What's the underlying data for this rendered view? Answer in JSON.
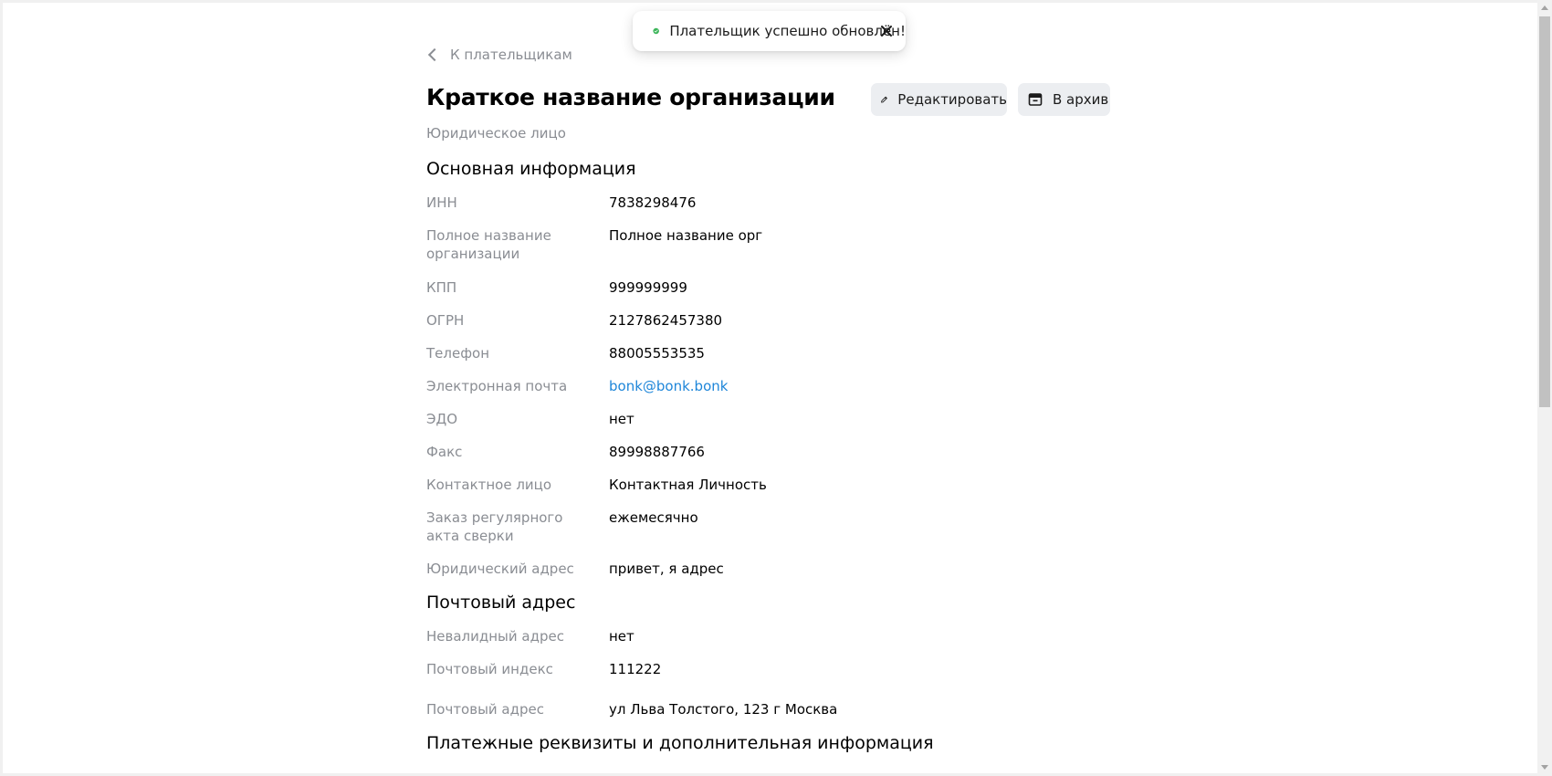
{
  "toast": {
    "message": "Плательщик успешно обновлён!",
    "success_color": "#3bb559"
  },
  "header": {
    "back_label": "К плательщикам",
    "title": "Краткое название организации",
    "subtitle": "Юридическое лицо",
    "edit_label": "Редактировать",
    "archive_label": "В архив"
  },
  "sections": {
    "main": {
      "title": "Основная информация",
      "rows": [
        {
          "label": "ИНН",
          "value": "7838298476"
        },
        {
          "label": "Полное название организации",
          "value": "Полное название орг"
        },
        {
          "label": "КПП",
          "value": "999999999"
        },
        {
          "label": "ОГРН",
          "value": "2127862457380"
        },
        {
          "label": "Телефон",
          "value": "88005553535"
        },
        {
          "label": "Электронная почта",
          "value": "bonk@bonk.bonk"
        },
        {
          "label": "ЭДО",
          "value": "нет"
        },
        {
          "label": "Факс",
          "value": "89998887766"
        },
        {
          "label": "Контактное лицо",
          "value": "Контактная Личность"
        },
        {
          "label": "Заказ регулярного акта сверки",
          "value": "ежемесячно"
        },
        {
          "label": "Юридический адрес",
          "value": "привет, я адрес"
        }
      ]
    },
    "postal": {
      "title": "Почтовый адрес",
      "rows": [
        {
          "label": "Невалидный адрес",
          "value": "нет"
        },
        {
          "label": "Почтовый индекс",
          "value": "111222"
        },
        {
          "label": "Почтовый адрес",
          "value": "ул Льва Толстого, 123 г Москва"
        }
      ]
    },
    "payment": {
      "title": "Платежные реквизиты и дополнительная информация"
    }
  },
  "colors": {
    "label": "#8a8d93",
    "link": "#1e86d9",
    "button_bg": "#eceef1"
  }
}
